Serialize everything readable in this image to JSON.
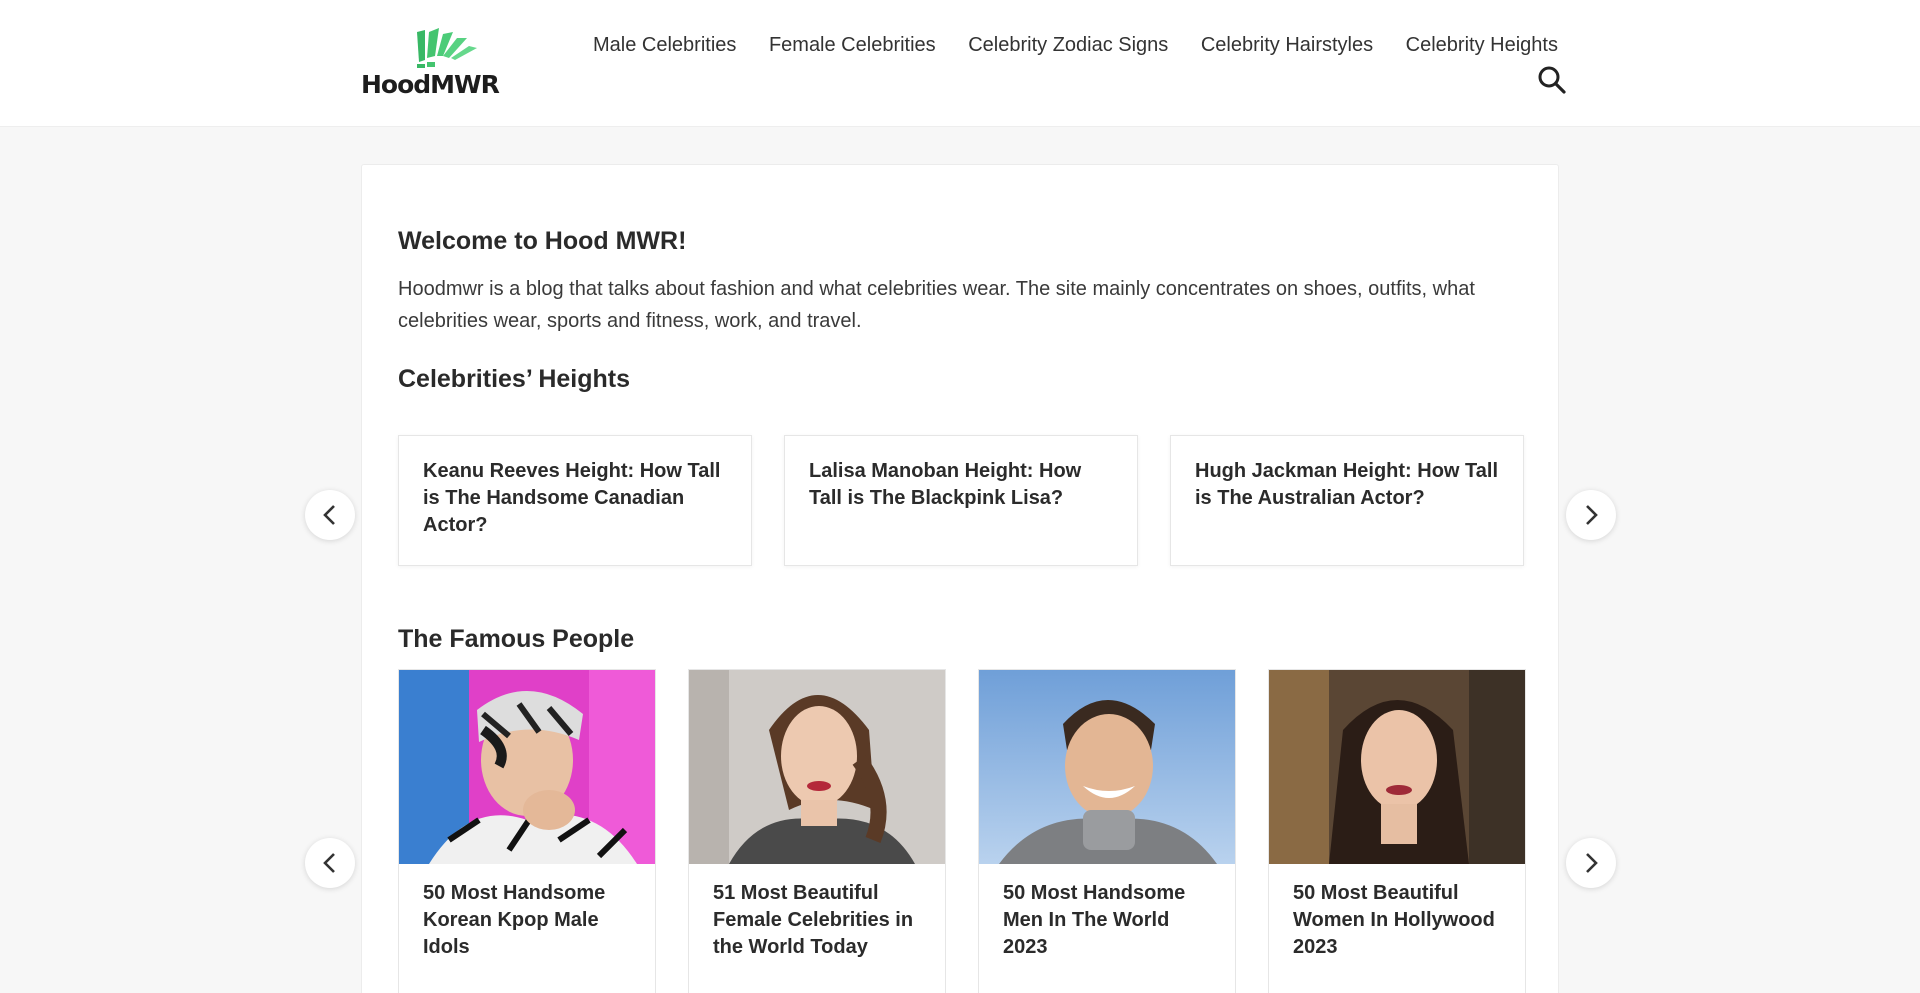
{
  "header": {
    "logo_text": "HoodMWR",
    "nav": [
      {
        "label": "Male Celebrities"
      },
      {
        "label": "Female Celebrities"
      },
      {
        "label": "Celebrity Zodiac Signs"
      },
      {
        "label": "Celebrity Hairstyles"
      },
      {
        "label": "Celebrity Heights"
      }
    ],
    "search_icon": "search-icon"
  },
  "intro": {
    "title": "Welcome to Hood MWR!",
    "text": "Hoodmwr is a blog that talks about fashion and what celebrities wear. The site mainly concentrates on shoes, outfits, what celebrities wear, sports and fitness, work, and travel."
  },
  "heights": {
    "title": "Celebrities’ Heights",
    "cards": [
      {
        "title": "Keanu Reeves Height: How Tall is The Handsome Canadian Actor?"
      },
      {
        "title": "Lalisa Manoban Height: How Tall is The Blackpink Lisa?"
      },
      {
        "title": "Hugh Jackman Height: How Tall is The Australian Actor?"
      }
    ]
  },
  "famous": {
    "title": "The Famous People",
    "cards": [
      {
        "title": "50 Most Handsome Korean Kpop Male Idols"
      },
      {
        "title": "51 Most Beautiful Female Celebrities in the World Today"
      },
      {
        "title": "50 Most Handsome Men In The World 2023"
      },
      {
        "title": "50 Most Beautiful Women In Hollywood 2023"
      }
    ]
  },
  "colors": {
    "brand_green": "#3fbf6a",
    "page_bg": "#f7f7f7",
    "text": "#222222"
  },
  "icons": {
    "prev": "chevron-left-icon",
    "next": "chevron-right-icon"
  }
}
